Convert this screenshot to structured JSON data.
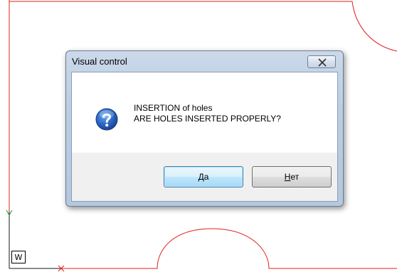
{
  "canvas": {
    "line_color": "#e0201e",
    "ucs_color": "#1a9a2a",
    "ucs_label": "W"
  },
  "dialog": {
    "title": "Visual control",
    "close_icon": "close-x-icon",
    "message_icon": "question-icon",
    "message_line1": "INSERTION of holes",
    "message_line2": "ARE HOLES INSERTED PROPERLY?",
    "yes_button": {
      "accel": "",
      "rest": "Да"
    },
    "no_button": {
      "accel": "Н",
      "rest": "ет"
    }
  }
}
